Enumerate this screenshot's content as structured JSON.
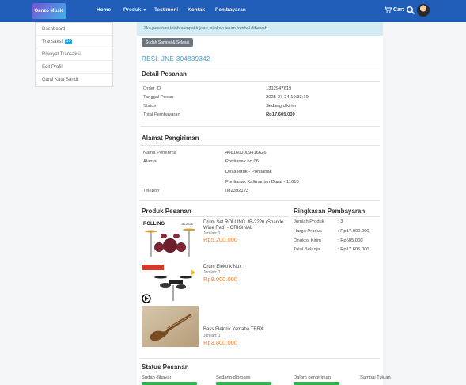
{
  "nav": {
    "logo_text": "Ganzo Music",
    "home": "Home",
    "produk": "Produk",
    "testimoni": "Testimoni",
    "kontak": "Kontak",
    "pembayaran": "Pembayaran",
    "cart": "Cart"
  },
  "sidebar": {
    "items": [
      {
        "label": "Dashboard"
      },
      {
        "label": "Transaksi",
        "badge": "10"
      },
      {
        "label": "Riwayat Transaksi"
      },
      {
        "label": "Edit Profil"
      },
      {
        "label": "Ganti Kata Sandi"
      }
    ]
  },
  "alert": {
    "text": "Jika pesanan telah sampai tujuan, silakan tekan tombol dibawah"
  },
  "done_button": "Sudah Sampai & Selesai",
  "resi": "RESI: JNE-304839342",
  "detail": {
    "title": "Detail Pesanan",
    "rows": [
      {
        "label": "Order ID",
        "value": "1312947619"
      },
      {
        "label": "Tanggal Pesan",
        "value": "2025-07-24 19:33:19"
      },
      {
        "label": "Status",
        "value": "Sedang dikirim"
      },
      {
        "label": "Total Pembayaran",
        "value": "Rp17.605.000"
      }
    ]
  },
  "alamat": {
    "title": "Alamat Pengiriman",
    "penerima_label": "Nama Penerima",
    "penerima_value": "4661601009416626",
    "alamat_label": "Alamat",
    "alamat_lines": [
      "Pontianak no 06",
      "Desa jeruk - Pontianak",
      "Pontianak Kalimantan Barat - 11610"
    ],
    "telepon_label": "Telepon",
    "telepon_value": "082392123"
  },
  "produk": {
    "title": "Produk Pesanan",
    "items": [
      {
        "name": "Drum Set ROLLING JB-2226 (Sparkle Wine Red) - ORIGINAL",
        "qty": "Jumlah: 1",
        "price": "Rp5.200.000"
      },
      {
        "name": "Drum Elektrik Nux",
        "qty": "Jumlah: 1",
        "price": "Rp8.000.000"
      },
      {
        "name": "Bass Elektrik Yamaha TBRX",
        "qty": "Jumlah: 1",
        "price": "Rp3.800.000"
      }
    ]
  },
  "ringkasan": {
    "title": "Ringkasan Pembayaran",
    "rows": [
      {
        "label": "Jumlah Produk",
        "value": ": 3"
      },
      {
        "label": "Harga Produk",
        "value": ": Rp17.000.000"
      },
      {
        "label": "Ongkos Kirim",
        "value": ": Rp605.000"
      },
      {
        "label": "Total Belanja",
        "value": ": Rp17.605.000"
      }
    ]
  },
  "status": {
    "title": "Status Pesanan",
    "steps": [
      {
        "label": "Sudah dibayar"
      },
      {
        "label": "Sedang diproses"
      },
      {
        "label": "Dalam pengiriman"
      },
      {
        "label": "Sampai Tujuan"
      }
    ]
  },
  "colors": {
    "navbar": "#1f5db8",
    "accent_blue": "#2a7fd4",
    "price_orange": "#f07f2d",
    "progress_green": "#33b24f"
  }
}
